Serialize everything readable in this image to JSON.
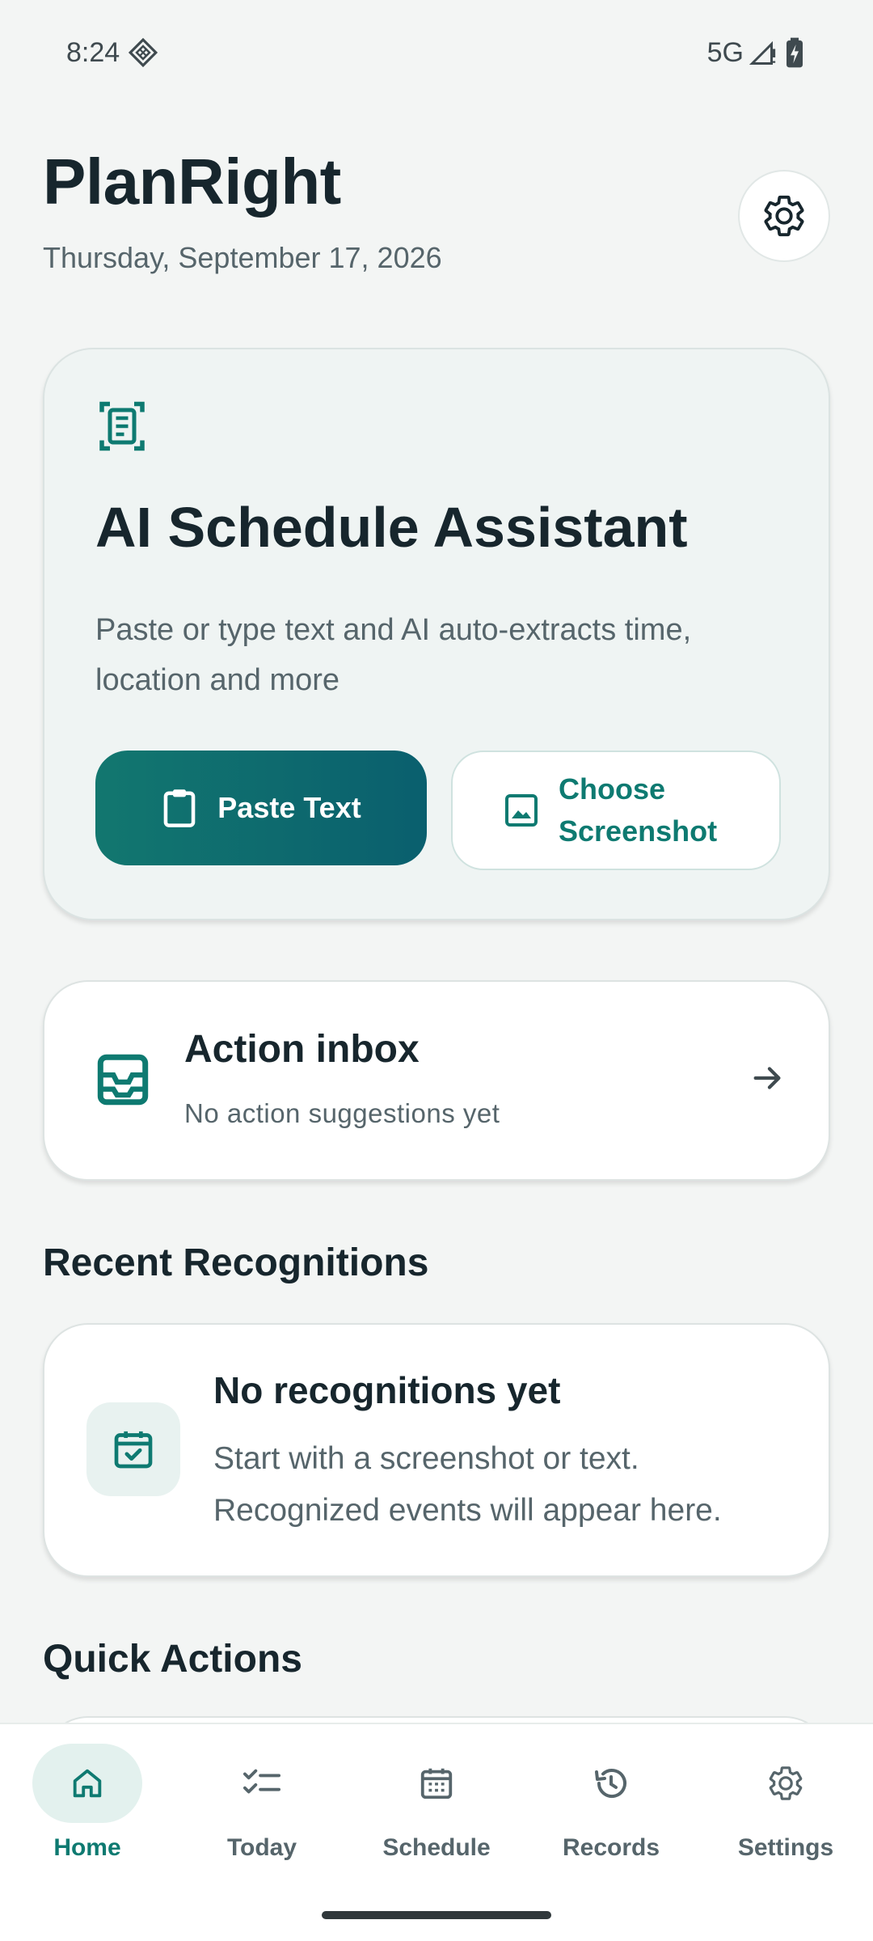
{
  "status_bar": {
    "time": "8:24",
    "network": "5G",
    "icons": [
      "notification-diamond-icon",
      "signal-icon",
      "battery-charging-icon"
    ]
  },
  "header": {
    "title": "PlanRight",
    "date": "Thursday, September 17, 2026",
    "settings_icon": "gear-icon"
  },
  "ai_card": {
    "icon": "document-scan-icon",
    "title": "AI Schedule Assistant",
    "description": "Paste or type text and AI auto-extracts time, location and more",
    "paste_button": {
      "label": "Paste Text",
      "icon": "clipboard-icon"
    },
    "screenshot_button": {
      "label": "Choose Screenshot",
      "icon": "image-icon"
    }
  },
  "inbox": {
    "icon": "inbox-icon",
    "title": "Action inbox",
    "subtitle": "No action suggestions yet",
    "arrow_icon": "arrow-right-icon"
  },
  "recent": {
    "section_title": "Recent Recognitions",
    "empty_title": "No recognitions yet",
    "empty_desc": "Start with a screenshot or text. Recognized events will appear here.",
    "icon": "calendar-check-icon"
  },
  "quick_actions": {
    "section_title": "Quick Actions"
  },
  "nav": {
    "items": [
      {
        "label": "Home",
        "icon": "home-icon",
        "active": true
      },
      {
        "label": "Today",
        "icon": "checklist-icon",
        "active": false
      },
      {
        "label": "Schedule",
        "icon": "calendar-icon",
        "active": false
      },
      {
        "label": "Records",
        "icon": "history-icon",
        "active": false
      },
      {
        "label": "Settings",
        "icon": "gear-icon",
        "active": false
      }
    ]
  },
  "colors": {
    "accent": "#0e7a71",
    "background": "#f3f5f4",
    "text_primary": "#17262d",
    "text_secondary": "#56656b"
  }
}
